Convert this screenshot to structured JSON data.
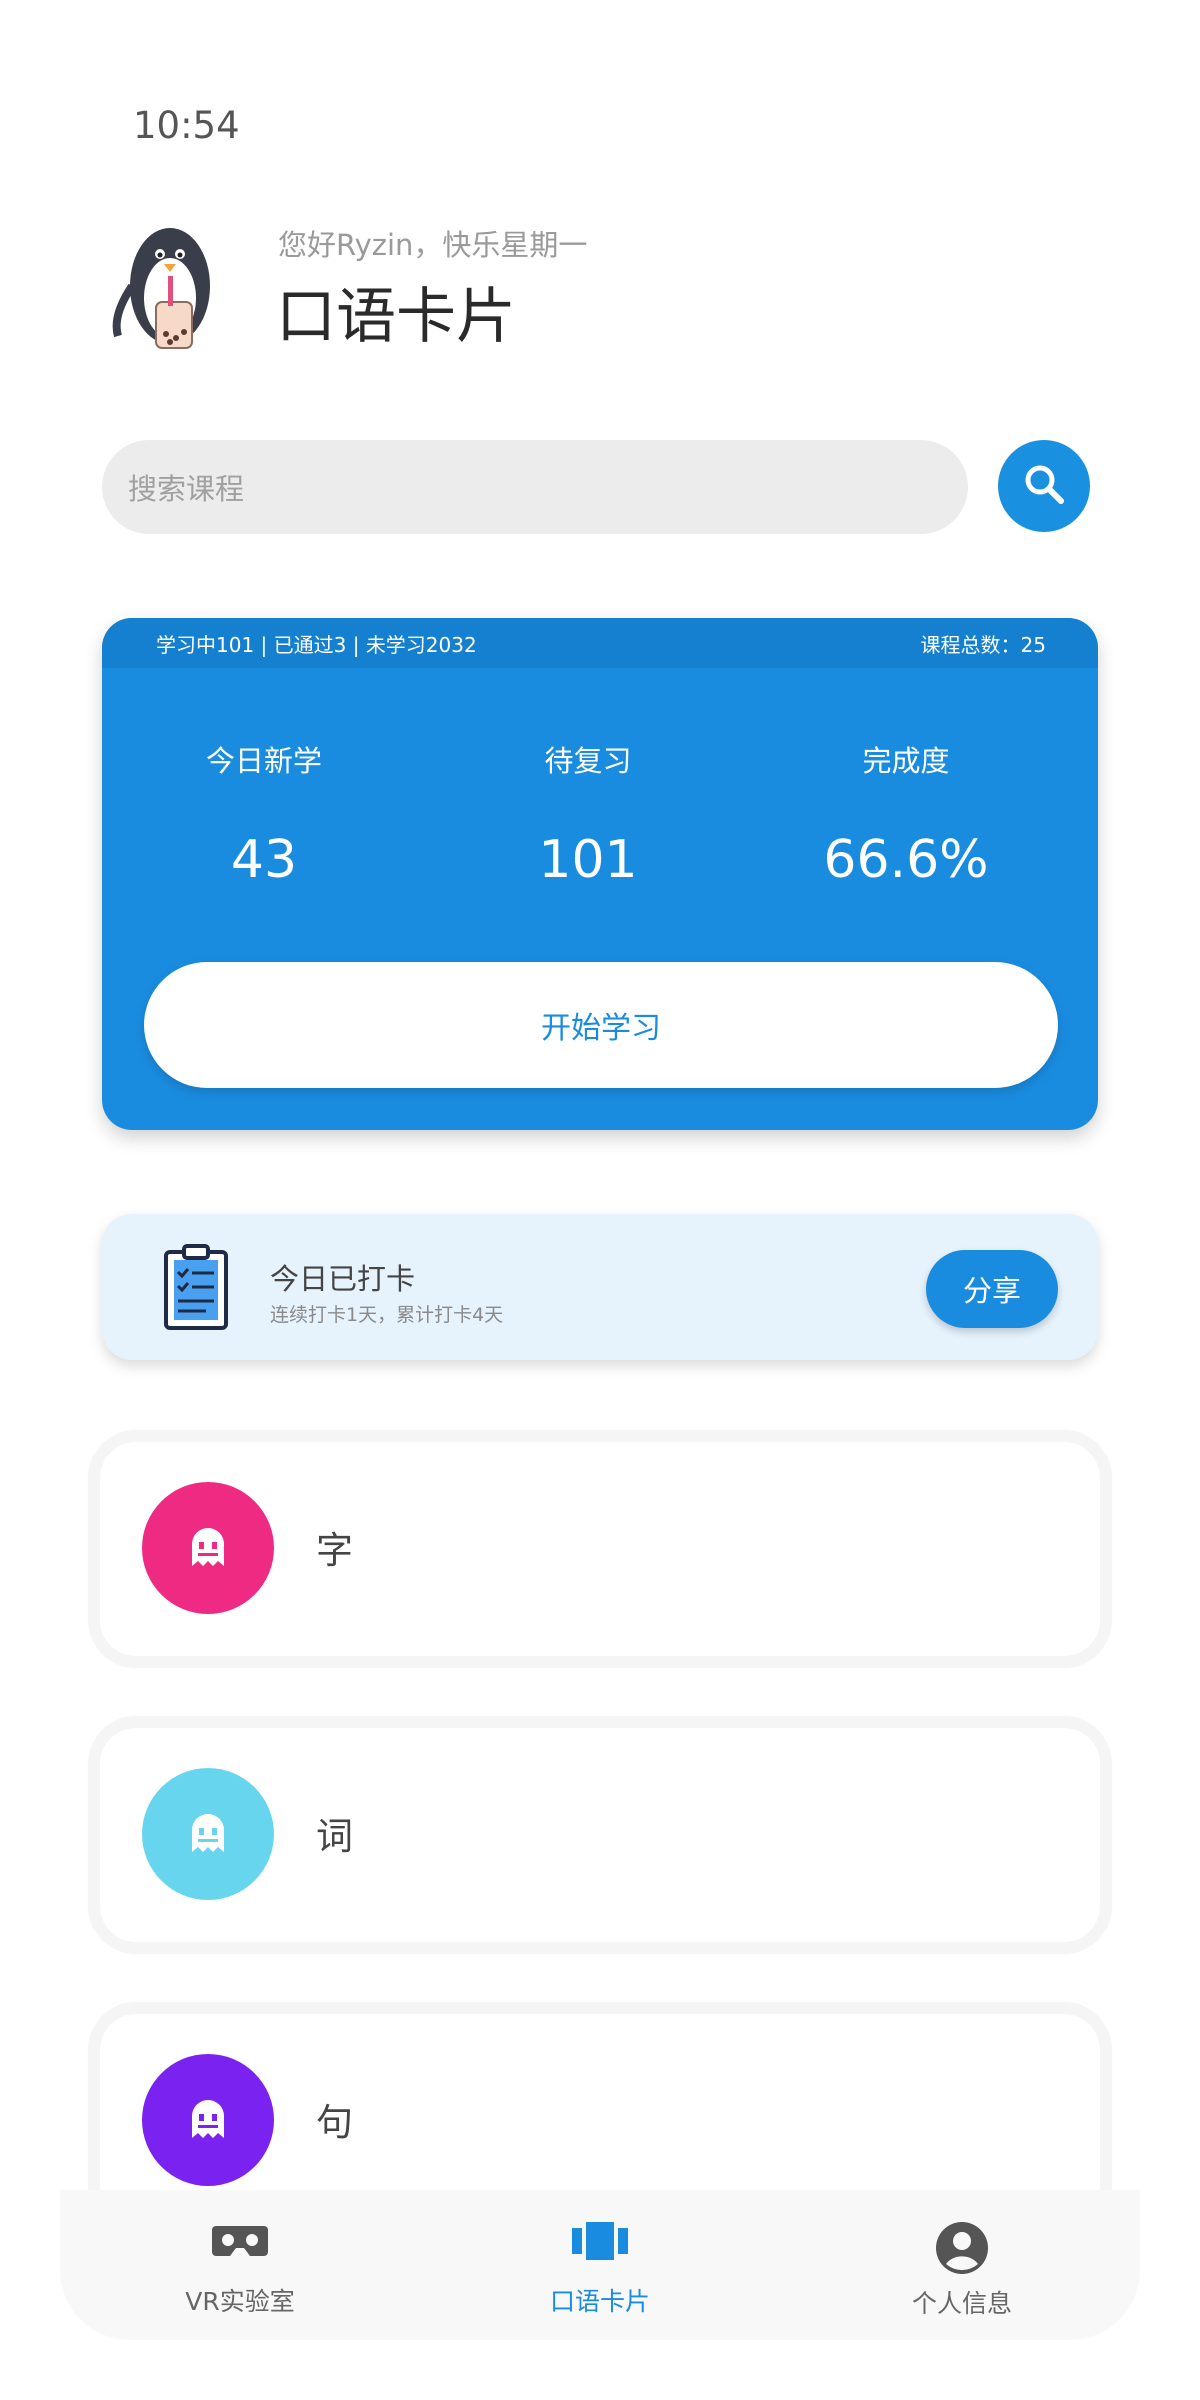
{
  "status_bar": {
    "time": "10:54"
  },
  "header": {
    "greeting": "您好Ryzin，快乐星期一",
    "title": "口语卡片",
    "mascot_icon": "penguin-bubble-tea-icon"
  },
  "search": {
    "placeholder": "搜索课程",
    "icon": "search-icon"
  },
  "study_card": {
    "summary": "学习中101 | 已通过3 | 未学习2032",
    "total": "课程总数：25",
    "stats": [
      {
        "label": "今日新学",
        "value": "43"
      },
      {
        "label": "待复习",
        "value": "101"
      },
      {
        "label": "完成度",
        "value": "66.6%"
      }
    ],
    "start_label": "开始学习",
    "accent": "#1a8ce0"
  },
  "checkin": {
    "title": "今日已打卡",
    "subtitle": "连续打卡1天，累计打卡4天",
    "share_label": "分享",
    "icon": "clipboard-checklist-icon"
  },
  "courses": [
    {
      "label": "字",
      "color": "#ee2a82",
      "icon": "ghost-icon"
    },
    {
      "label": "词",
      "color": "#68d5ef",
      "icon": "ghost-icon"
    },
    {
      "label": "句",
      "color": "#7a22f0",
      "icon": "ghost-icon"
    }
  ],
  "bottom_nav": [
    {
      "label": "VR实验室",
      "icon": "vr-headset-icon",
      "active": false
    },
    {
      "label": "口语卡片",
      "icon": "cards-icon",
      "active": true
    },
    {
      "label": "个人信息",
      "icon": "account-circle-icon",
      "active": false
    }
  ]
}
